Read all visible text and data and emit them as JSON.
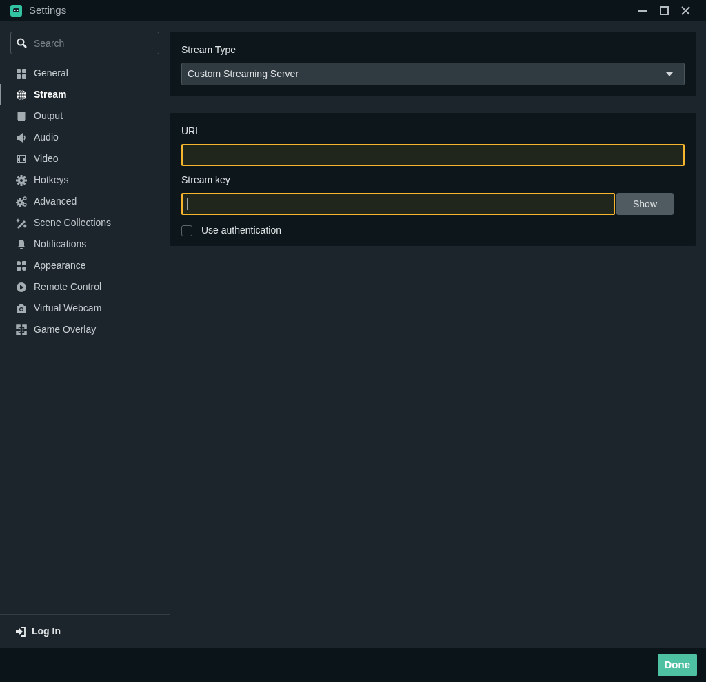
{
  "window": {
    "title": "Settings"
  },
  "sidebar": {
    "search": {
      "placeholder": "Search"
    },
    "items": [
      {
        "label": "General",
        "selected": false
      },
      {
        "label": "Stream",
        "selected": true
      },
      {
        "label": "Output",
        "selected": false
      },
      {
        "label": "Audio",
        "selected": false
      },
      {
        "label": "Video",
        "selected": false
      },
      {
        "label": "Hotkeys",
        "selected": false
      },
      {
        "label": "Advanced",
        "selected": false
      },
      {
        "label": "Scene Collections",
        "selected": false
      },
      {
        "label": "Notifications",
        "selected": false
      },
      {
        "label": "Appearance",
        "selected": false
      },
      {
        "label": "Remote Control",
        "selected": false
      },
      {
        "label": "Virtual Webcam",
        "selected": false
      },
      {
        "label": "Game Overlay",
        "selected": false
      }
    ],
    "login": "Log In"
  },
  "stream_type": {
    "label": "Stream Type",
    "value": "Custom Streaming Server"
  },
  "server": {
    "fields": [
      {
        "label": "URL",
        "invalid": true,
        "focused": false
      },
      {
        "label": "Stream key",
        "invalid": true,
        "focused": true,
        "button": "Show"
      }
    ],
    "auth": {
      "label": "Use authentication",
      "checked": false
    }
  },
  "footer": {
    "done": "Done"
  }
}
